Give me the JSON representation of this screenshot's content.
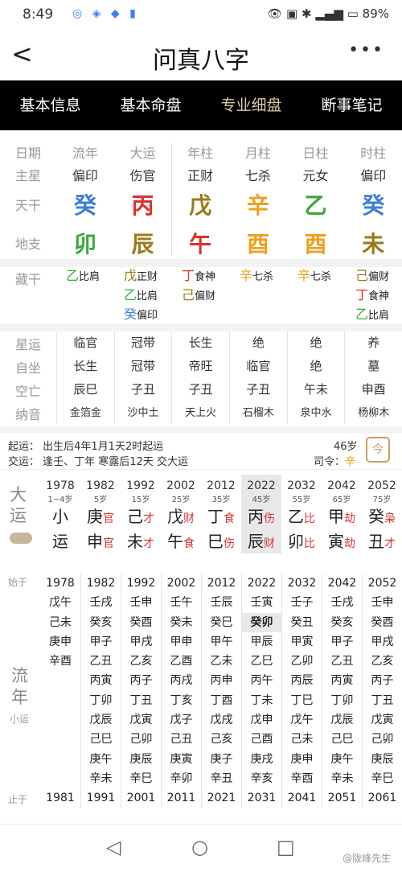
{
  "status": {
    "time": "8:49",
    "battery": "89%"
  },
  "header": {
    "title": "问真八字",
    "back": "<",
    "more": "•••"
  },
  "tabs": [
    "基本信息",
    "基本命盘",
    "专业细盘",
    "断事笔记"
  ],
  "pillars": {
    "headers": [
      "日期",
      "流年",
      "大运",
      "年柱",
      "月柱",
      "日柱",
      "时柱"
    ],
    "zhuxing": {
      "label": "主星",
      "values": [
        "偏印",
        "伤官",
        "正财",
        "七杀",
        "元女",
        "偏印"
      ]
    },
    "tiangan": {
      "label": "天干",
      "values": [
        "癸",
        "丙",
        "戊",
        "辛",
        "乙",
        "癸"
      ],
      "colors": [
        "#3b7fd9",
        "#d9332b",
        "#9a7b1a",
        "#f0a020",
        "#3aa83a",
        "#3b7fd9"
      ]
    },
    "dizhi": {
      "label": "地支",
      "values": [
        "卯",
        "辰",
        "午",
        "酉",
        "酉",
        "未"
      ],
      "colors": [
        "#3aa83a",
        "#9a7b1a",
        "#d9332b",
        "#f0a020",
        "#f0a020",
        "#9a7b1a"
      ]
    }
  },
  "canggan": {
    "label": "藏干",
    "cols": [
      [
        [
          "乙",
          "比肩",
          "#3aa83a"
        ]
      ],
      [
        [
          "戊",
          "正财",
          "#9a7b1a"
        ],
        [
          "乙",
          "比肩",
          "#3aa83a"
        ],
        [
          "癸",
          "偏印",
          "#3b7fd9"
        ]
      ],
      [
        [
          "丁",
          "食神",
          "#d9332b"
        ],
        [
          "己",
          "偏财",
          "#9a7b1a"
        ]
      ],
      [
        [
          "辛",
          "七杀",
          "#f0a020"
        ]
      ],
      [
        [
          "辛",
          "七杀",
          "#f0a020"
        ]
      ],
      [
        [
          "己",
          "偏财",
          "#9a7b1a"
        ],
        [
          "丁",
          "食神",
          "#d9332b"
        ],
        [
          "乙",
          "比肩",
          "#3aa83a"
        ]
      ]
    ]
  },
  "table2": [
    {
      "label": "星运",
      "values": [
        "临官",
        "冠带",
        "长生",
        "绝",
        "绝",
        "养"
      ]
    },
    {
      "label": "自坐",
      "values": [
        "长生",
        "冠带",
        "帝旺",
        "临官",
        "绝",
        "墓"
      ]
    },
    {
      "label": "空亡",
      "values": [
        "辰巳",
        "子丑",
        "子丑",
        "子丑",
        "午未",
        "申酉"
      ]
    },
    {
      "label": "纳音",
      "values": [
        "金箔金",
        "沙中土",
        "天上火",
        "石榴木",
        "泉中水",
        "杨柳木"
      ]
    }
  ],
  "qiyun": {
    "line1": "起运：  出生后4年1月1天2时起运",
    "line2": "交运：  逢壬、丁年 寒露后12天 交大运",
    "age": "46岁",
    "siling_label": "司令：",
    "siling_val": "辛",
    "cal": "今"
  },
  "dayun": {
    "label": "大运",
    "cols": [
      {
        "yr": "1978",
        "age": "1~4岁",
        "g": "小",
        "z": "运",
        "gs": "",
        "zs": ""
      },
      {
        "yr": "1982",
        "age": "5岁",
        "g": "庚",
        "z": "申",
        "gs": "官",
        "zs": "官"
      },
      {
        "yr": "1992",
        "age": "15岁",
        "g": "己",
        "z": "未",
        "gs": "才",
        "zs": "才"
      },
      {
        "yr": "2002",
        "age": "25岁",
        "g": "戊",
        "z": "午",
        "gs": "财",
        "zs": "食"
      },
      {
        "yr": "2012",
        "age": "35岁",
        "g": "丁",
        "z": "巳",
        "gs": "食",
        "zs": "伤"
      },
      {
        "yr": "2022",
        "age": "45岁",
        "g": "丙",
        "z": "辰",
        "gs": "伤",
        "zs": "财"
      },
      {
        "yr": "2032",
        "age": "55岁",
        "g": "乙",
        "z": "卯",
        "gs": "比",
        "zs": "比"
      },
      {
        "yr": "2042",
        "age": "65岁",
        "g": "甲",
        "z": "寅",
        "gs": "劫",
        "zs": "劫"
      },
      {
        "yr": "2052",
        "age": "75岁",
        "g": "癸",
        "z": "丑",
        "gs": "枭",
        "zs": "才"
      }
    ]
  },
  "liunian": {
    "start_label": "始于",
    "end_label": "止于",
    "label": "流年",
    "sub": "小运",
    "cols": [
      [
        "1978",
        "戊午",
        "己未",
        "庚申",
        "辛酉",
        "",
        "",
        "",
        "",
        "",
        "",
        "1981"
      ],
      [
        "1982",
        "壬戌",
        "癸亥",
        "甲子",
        "乙丑",
        "丙寅",
        "丁卯",
        "戊辰",
        "己巳",
        "庚午",
        "辛未",
        "1991"
      ],
      [
        "1992",
        "壬申",
        "癸酉",
        "甲戌",
        "乙亥",
        "丙子",
        "丁丑",
        "戊寅",
        "己卯",
        "庚辰",
        "辛巳",
        "2001"
      ],
      [
        "2002",
        "壬午",
        "癸未",
        "甲申",
        "乙酉",
        "丙戌",
        "丁亥",
        "戊子",
        "己丑",
        "庚寅",
        "辛卯",
        "2011"
      ],
      [
        "2012",
        "壬辰",
        "癸巳",
        "甲午",
        "乙未",
        "丙申",
        "丁酉",
        "戊戌",
        "己亥",
        "庚子",
        "辛丑",
        "2021"
      ],
      [
        "2022",
        "壬寅",
        "癸卯",
        "甲辰",
        "乙巳",
        "丙午",
        "丁未",
        "戊申",
        "己酉",
        "庚戌",
        "辛亥",
        "2031"
      ],
      [
        "2032",
        "壬子",
        "癸丑",
        "甲寅",
        "乙卯",
        "丙辰",
        "丁巳",
        "戊午",
        "己未",
        "庚申",
        "辛酉",
        "2041"
      ],
      [
        "2042",
        "壬戌",
        "癸亥",
        "甲子",
        "乙丑",
        "丙寅",
        "丁卯",
        "戊辰",
        "己巳",
        "庚午",
        "辛未",
        "2051"
      ],
      [
        "2052",
        "壬申",
        "癸酉",
        "甲戌",
        "乙亥",
        "丙子",
        "丁丑",
        "戊寅",
        "己卯",
        "庚辰",
        "辛巳",
        "2061"
      ]
    ]
  },
  "watermark": "@陇峰先生"
}
